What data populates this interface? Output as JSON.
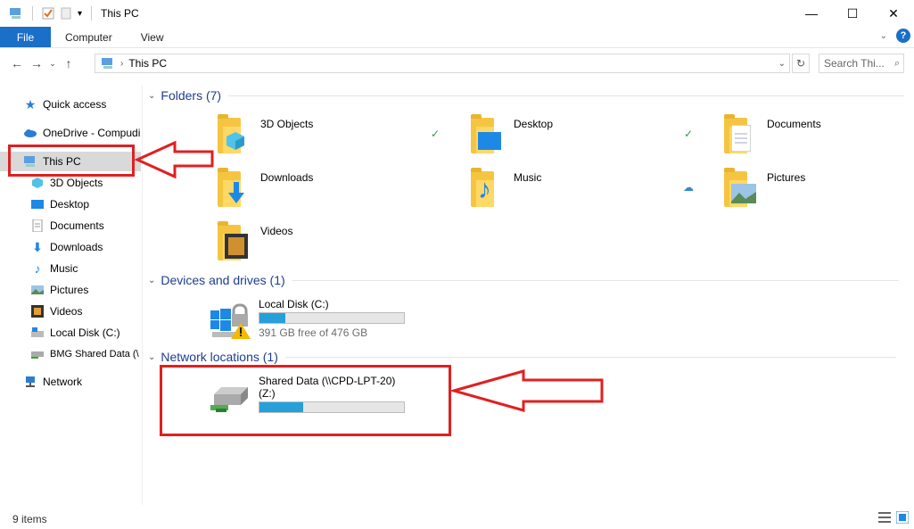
{
  "window": {
    "title": "This PC"
  },
  "ribbon": {
    "tabs": [
      "File",
      "Computer",
      "View"
    ]
  },
  "address": {
    "path": "This PC",
    "search_placeholder": "Search This PC"
  },
  "sidebar": {
    "items": [
      {
        "label": "Quick access",
        "icon": "star-icon"
      },
      {
        "label": "OneDrive - Compudi",
        "icon": "cloud-icon"
      },
      {
        "label": "This PC",
        "icon": "computer-icon"
      },
      {
        "label": "3D Objects",
        "icon": "cube-icon"
      },
      {
        "label": "Desktop",
        "icon": "desktop-icon"
      },
      {
        "label": "Documents",
        "icon": "documents-icon"
      },
      {
        "label": "Downloads",
        "icon": "download-icon"
      },
      {
        "label": "Music",
        "icon": "music-icon"
      },
      {
        "label": "Pictures",
        "icon": "pictures-icon"
      },
      {
        "label": "Videos",
        "icon": "videos-icon"
      },
      {
        "label": "Local Disk (C:)",
        "icon": "drive-icon"
      },
      {
        "label": "BMG Shared Data (\\",
        "icon": "network-drive-icon"
      },
      {
        "label": "Network",
        "icon": "network-icon"
      }
    ]
  },
  "content": {
    "folders_header": "Folders (7)",
    "folders": [
      {
        "name": "3D Objects"
      },
      {
        "name": "Desktop"
      },
      {
        "name": "Documents"
      },
      {
        "name": "Downloads"
      },
      {
        "name": "Music"
      },
      {
        "name": "Pictures"
      },
      {
        "name": "Videos"
      }
    ],
    "devices_header": "Devices and drives (1)",
    "local_disk": {
      "name": "Local Disk (C:)",
      "free": "391 GB free of 476 GB",
      "used_fraction": 0.18
    },
    "network_header": "Network locations (1)",
    "network_drive": {
      "name": "Shared Data (\\\\CPD-LPT-20)",
      "letter": "(Z:)",
      "used_fraction": 0.3
    }
  },
  "status": {
    "items": "9 items"
  },
  "colors": {
    "accent": "#1a6fc9",
    "annotation": "#e02020",
    "bar_fill": "#26a0da"
  }
}
